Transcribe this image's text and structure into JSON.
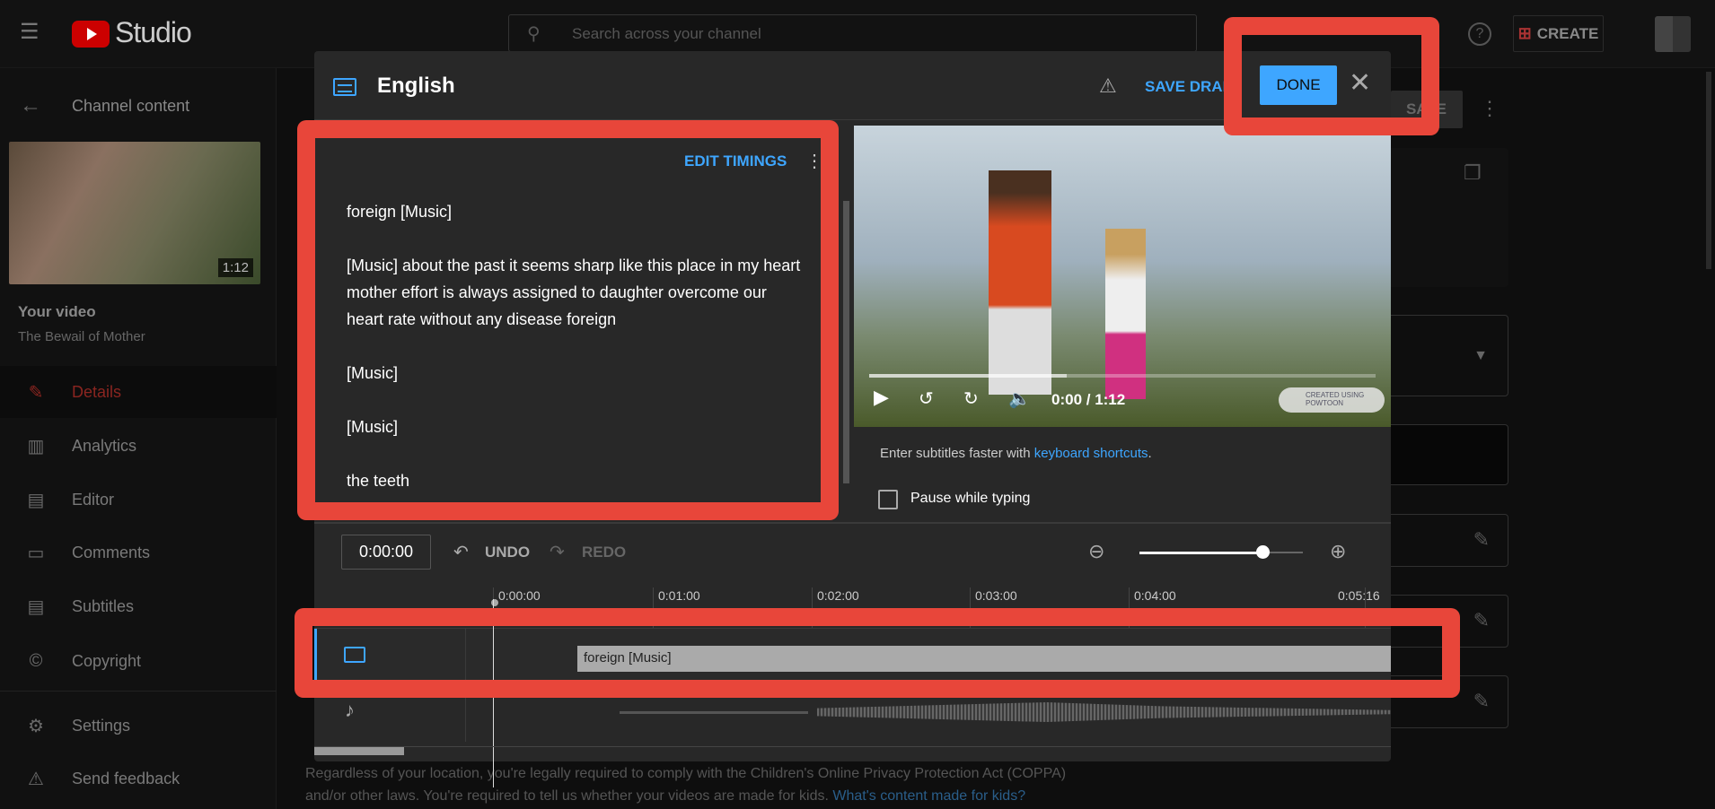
{
  "header": {
    "app_name": "Studio",
    "search_placeholder": "Search across your channel",
    "create_label": "CREATE"
  },
  "sidebar": {
    "back_label": "Channel content",
    "thumbnail_duration": "1:12",
    "your_video_label": "Your video",
    "video_title": "The Bewail of Mother",
    "items": [
      {
        "label": "Details",
        "icon": "pencil-icon",
        "active": true
      },
      {
        "label": "Analytics",
        "icon": "analytics-icon"
      },
      {
        "label": "Editor",
        "icon": "editor-icon"
      },
      {
        "label": "Comments",
        "icon": "comments-icon"
      },
      {
        "label": "Subtitles",
        "icon": "subtitles-icon"
      },
      {
        "label": "Copyright",
        "icon": "copyright-icon"
      },
      {
        "label": "Settings",
        "icon": "gear-icon"
      },
      {
        "label": "Send feedback",
        "icon": "feedback-icon"
      }
    ]
  },
  "background": {
    "save_label": "SAVE",
    "coppa_text": "Regardless of your location, you're legally required to comply with the Children's Online Privacy Protection Act (COPPA)",
    "coppa_text2": "and/or other laws. You're required to tell us whether your videos are made for kids.",
    "coppa_link": "What's content made for kids?"
  },
  "modal": {
    "title": "English",
    "save_draft_label": "SAVE DRAFT",
    "done_label": "DONE",
    "edit_timings_label": "EDIT TIMINGS",
    "captions": [
      "foreign [Music]",
      "[Music] about the past it seems sharp like this place in my heart mother effort is always assigned to daughter overcome our heart rate without any disease foreign",
      "[Music]",
      "[Music]",
      "the teeth"
    ],
    "player": {
      "time": "0:00 / 1:12",
      "watermark": "CREATED USING POWTOON",
      "progress_buffered": 0.39
    },
    "hint_text": "Enter subtitles faster with",
    "hint_link": "keyboard shortcuts",
    "hint_end": ".",
    "pause_label": "Pause while typing",
    "pause_checked": false,
    "timecode": "0:00:00",
    "undo_label": "UNDO",
    "redo_label": "REDO",
    "zoom_level": 0.75,
    "ruler": [
      "0:00:00",
      "0:01:00",
      "0:02:00",
      "0:03:00",
      "0:04:00",
      "0:05:16"
    ],
    "track_caption": "foreign [Music]"
  },
  "colors": {
    "accent": "#3ea6ff",
    "highlight": "#e8463a",
    "brand_red": "#ff0000"
  }
}
